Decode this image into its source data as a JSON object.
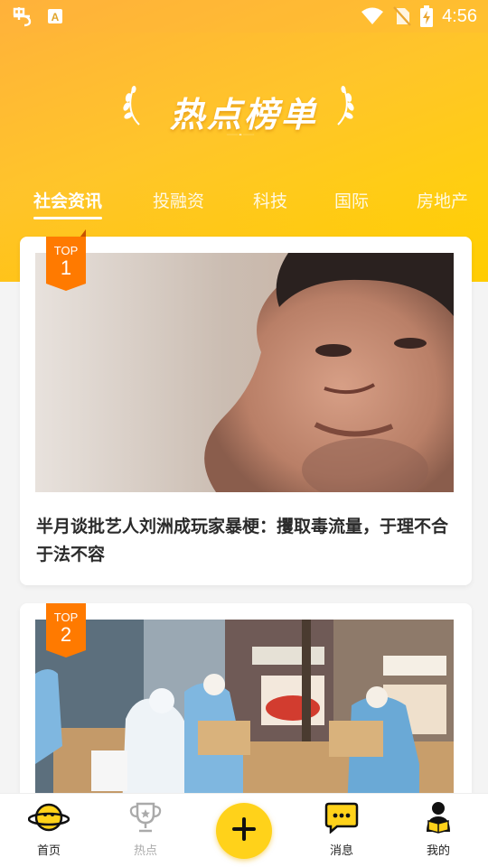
{
  "status_bar": {
    "time": "4:56",
    "left_icons": [
      "app-logo-icon",
      "a-box-icon"
    ],
    "right_icons": [
      "wifi-icon",
      "no-sim-icon",
      "battery-charging-icon"
    ]
  },
  "header": {
    "title": "热点榜单"
  },
  "tabs": [
    {
      "label": "社会资讯",
      "active": true
    },
    {
      "label": "投融资",
      "active": false
    },
    {
      "label": "科技",
      "active": false
    },
    {
      "label": "国际",
      "active": false
    },
    {
      "label": "房地产",
      "active": false
    }
  ],
  "cards": [
    {
      "badge_text": "TOP",
      "rank": "1",
      "headline": "半月谈批艺人刘洲成玩家暴梗：攫取毒流量，于理不合于法不容"
    },
    {
      "badge_text": "TOP",
      "rank": "2",
      "headline": ""
    }
  ],
  "bottom_nav": [
    {
      "label": "首页",
      "icon": "planet-icon"
    },
    {
      "label": "热点",
      "icon": "trophy-icon"
    },
    {
      "label": "",
      "icon": "plus-icon"
    },
    {
      "label": "消息",
      "icon": "chat-bubble-icon"
    },
    {
      "label": "我的",
      "icon": "person-reading-icon"
    }
  ],
  "colors": {
    "accent": "#ffd21a",
    "badge": "#ff7a00",
    "header_start": "#ffb13b",
    "header_end": "#ffd400"
  }
}
